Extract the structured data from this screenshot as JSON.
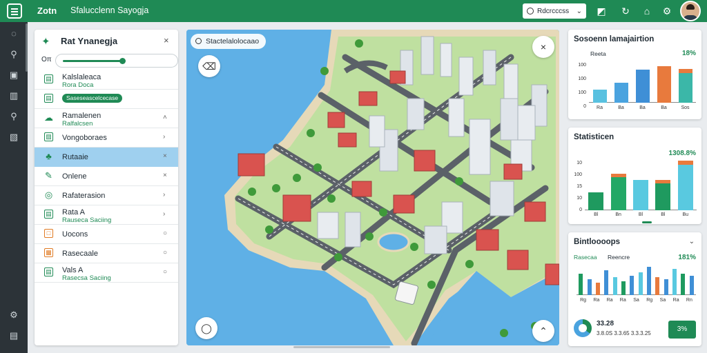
{
  "header": {
    "app_title": "Zotn",
    "project_title": "Sfalucclenn Sayogja",
    "search_label": "Rdcrcccss",
    "icons": [
      "map-pin-icon",
      "refresh-icon",
      "home-icon",
      "settings-icon"
    ]
  },
  "rail": {
    "icons": [
      "globe-icon",
      "pin-icon",
      "layers-icon",
      "chart-icon",
      "search-icon",
      "info-icon",
      "settings-icon",
      "table-icon"
    ]
  },
  "layers": {
    "title": "Rat Ynanegja",
    "opacity_label": "Oπ",
    "opacity_value": 0.55,
    "items": [
      {
        "name": "Kalslaleaca",
        "sub": "Rora Doca",
        "badge": "",
        "action": "",
        "icon": "grid-icon",
        "glyph": "▤",
        "style": ""
      },
      {
        "name": "",
        "sub": "",
        "badge": "Saseseascelcecase",
        "action": "",
        "icon": "grid-icon",
        "glyph": "▤",
        "style": ""
      },
      {
        "name": "Ramalenen",
        "sub": "Ralfalcsen",
        "badge": "",
        "action": "˄",
        "icon": "cloud-icon",
        "glyph": "☁",
        "style": "glyph"
      },
      {
        "name": "Vongoboraes",
        "sub": "",
        "badge": "",
        "action": "›",
        "icon": "image-icon",
        "glyph": "▨",
        "style": ""
      },
      {
        "name": "Rutaaie",
        "sub": "",
        "badge": "",
        "action": "×",
        "icon": "tree-icon",
        "glyph": "♣",
        "style": "glyph"
      },
      {
        "name": "Onlene",
        "sub": "",
        "badge": "",
        "action": "×",
        "icon": "edit-icon",
        "glyph": "✎",
        "style": "glyph"
      },
      {
        "name": "Rafaterasion",
        "sub": "",
        "badge": "",
        "action": "›",
        "icon": "target-icon",
        "glyph": "◎",
        "style": "glyph"
      },
      {
        "name": "Rata A",
        "sub": "Rauseca Saciing",
        "badge": "",
        "action": "›",
        "icon": "grid-icon",
        "glyph": "▤",
        "style": ""
      },
      {
        "name": "Uocons",
        "sub": "",
        "badge": "",
        "action": "○",
        "icon": "square-icon",
        "glyph": "□",
        "style": "orange"
      },
      {
        "name": "Rasecaale",
        "sub": "",
        "badge": "",
        "action": "○",
        "icon": "chart-icon",
        "glyph": "▩",
        "style": "orange"
      },
      {
        "name": "Vals A",
        "sub": "Rasecsa Saciing",
        "badge": "",
        "action": "○",
        "icon": "file-icon",
        "glyph": "▤",
        "style": ""
      }
    ]
  },
  "map": {
    "layer_label": "Stactelalolocaao",
    "colors": {
      "water": "#5fb0e6",
      "land": "#bfe0a0",
      "road": "#5b6168",
      "roof": "#d9534f"
    }
  },
  "panel1": {
    "title": "Sosoenn lamajairtion",
    "legend": "Reeta",
    "value": "18%",
    "yticks": [
      "100",
      "100",
      "100",
      "0"
    ],
    "categories": [
      "Ra",
      "Ba",
      "Ba",
      "Ba",
      "Sos"
    ],
    "values": [
      20,
      30,
      50,
      50,
      45
    ],
    "tops": [
      0,
      0,
      0,
      5,
      6
    ],
    "colors": [
      "#59c1e0",
      "#4aa3df",
      "#3f8fd6",
      "#e87a3d",
      "#3bb7a8"
    ]
  },
  "panel2": {
    "title": "Statisticen",
    "value": "1308.8%",
    "yticks": [
      "10",
      "100",
      "15",
      "10",
      "0"
    ],
    "categories": [
      "Bl",
      "Bn",
      "Bl",
      "Bl",
      "Bu"
    ],
    "values": [
      30,
      55,
      50,
      45,
      75
    ],
    "tops": [
      0,
      6,
      0,
      5,
      7
    ],
    "colors": [
      "#1f9a5f",
      "#23a866",
      "#59c9e0",
      "#1f9a5f",
      "#59c9e0"
    ]
  },
  "panel3": {
    "title": "Bintloooops",
    "legend_left": "Rasecaa",
    "legend_mid": "Reencre",
    "value": "181%",
    "xticks": [
      "Rg",
      "Ra",
      "Ra",
      "Ra",
      "Sa",
      "Rg",
      "Sa",
      "Ra",
      "Rn"
    ],
    "values": [
      60,
      45,
      35,
      70,
      50,
      40,
      55,
      65,
      80,
      50,
      45,
      75,
      60,
      55
    ],
    "colors": [
      "#1f9a5f",
      "#3f8fd6",
      "#e87a3d",
      "#3f8fd6",
      "#59c9e0",
      "#1f9a5f",
      "#3f8fd6",
      "#59c9e0",
      "#3f8fd6",
      "#e87a3d",
      "#3f8fd6",
      "#59c9e0",
      "#1f9a5f",
      "#3f8fd6"
    ],
    "stat_value": "33.28",
    "stat_sub": "3.8.0S 3.3.65 3.3.3.25",
    "button_label": "3%",
    "donut_share": 0.35
  }
}
